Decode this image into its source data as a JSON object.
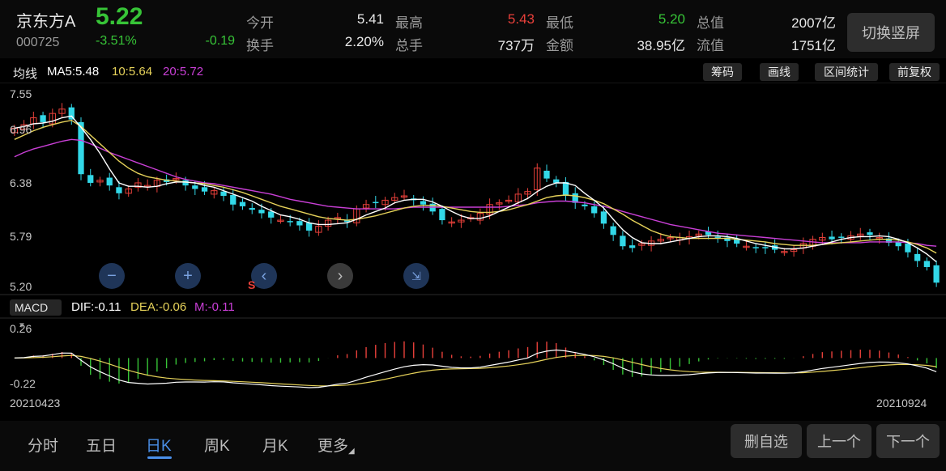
{
  "header": {
    "name": "京东方A",
    "code": "000725",
    "price": "5.22",
    "change_pct": "-3.51%",
    "change": "-0.19",
    "stats": [
      {
        "label": "今开",
        "value": "5.41",
        "color": "normal"
      },
      {
        "label": "最高",
        "value": "5.43",
        "color": "red"
      },
      {
        "label": "最低",
        "value": "5.20",
        "color": "green"
      },
      {
        "label": "总值",
        "value": "2007亿",
        "color": "normal"
      },
      {
        "label": "换手",
        "value": "2.20%",
        "color": "normal"
      },
      {
        "label": "总手",
        "value": "737万",
        "color": "normal"
      },
      {
        "label": "金额",
        "value": "38.95亿",
        "color": "normal"
      },
      {
        "label": "流值",
        "value": "1751亿",
        "color": "normal"
      }
    ],
    "switch_label": "切换竖屏"
  },
  "ma": {
    "title": "均线",
    "ma5": "MA5:5.48",
    "ma10": "10:5.64",
    "ma20": "20:5.72",
    "tools": [
      "筹码",
      "画线",
      "区间统计",
      "前复权"
    ]
  },
  "axis": {
    "price_ticks": [
      "7.55",
      "6.96",
      "6.38",
      "5.79",
      "5.20"
    ],
    "macd_ticks": [
      "0.26",
      "-0.22"
    ],
    "start_date": "20210423",
    "end_date": "20210924"
  },
  "macd": {
    "tag": "MACD",
    "dif": "DIF:-0.11",
    "dea": "DEA:-0.06",
    "m": "M:-0.11"
  },
  "marker": "S",
  "tabs": [
    "分时",
    "五日",
    "日K",
    "周K",
    "月K",
    "更多"
  ],
  "active_tab": "日K",
  "buttons": [
    "删自选",
    "上一个",
    "下一个"
  ],
  "colors": {
    "up": "#e8403a",
    "down": "#32d8e8",
    "ma5": "#ffffff",
    "ma10": "#e6d25a",
    "ma20": "#c93fd6",
    "accent": "#4a8fe8"
  },
  "chart_data": {
    "type": "candlestick",
    "y_range": [
      5.2,
      7.55
    ],
    "closes": [
      7.08,
      7.12,
      7.2,
      7.15,
      7.25,
      7.3,
      7.18,
      6.55,
      6.45,
      6.48,
      6.42,
      6.33,
      6.38,
      6.45,
      6.42,
      6.48,
      6.46,
      6.5,
      6.42,
      6.38,
      6.35,
      6.36,
      6.3,
      6.2,
      6.18,
      6.14,
      6.1,
      6.05,
      6.02,
      6.0,
      5.96,
      5.9,
      5.95,
      6.02,
      6.05,
      6.0,
      6.15,
      6.2,
      6.22,
      6.25,
      6.28,
      6.3,
      6.25,
      6.2,
      6.12,
      6.02,
      6.0,
      6.02,
      6.05,
      6.1,
      6.2,
      6.22,
      6.25,
      6.32,
      6.35,
      6.62,
      6.5,
      6.45,
      6.3,
      6.22,
      6.18,
      6.1,
      5.98,
      5.85,
      5.72,
      5.7,
      5.75,
      5.78,
      5.8,
      5.82,
      5.82,
      5.83,
      5.86,
      5.85,
      5.82,
      5.78,
      5.75,
      5.72,
      5.7,
      5.7,
      5.68,
      5.66,
      5.68,
      5.75,
      5.8,
      5.82,
      5.8,
      5.82,
      5.84,
      5.86,
      5.85,
      5.82,
      5.76,
      5.72,
      5.65,
      5.55,
      5.48,
      5.3
    ],
    "ma5": [
      7.08,
      7.1,
      7.13,
      7.14,
      7.16,
      7.2,
      7.22,
      7.09,
      6.95,
      6.79,
      6.61,
      6.45,
      6.41,
      6.41,
      6.4,
      6.41,
      6.44,
      6.46,
      6.46,
      6.45,
      6.42,
      6.4,
      6.36,
      6.32,
      6.28,
      6.24,
      6.18,
      6.13,
      6.08,
      6.06,
      6.03,
      5.99,
      5.97,
      5.97,
      5.98,
      5.99,
      6.03,
      6.08,
      6.12,
      6.16,
      6.22,
      6.25,
      6.26,
      6.26,
      6.23,
      6.18,
      6.12,
      6.07,
      6.04,
      6.04,
      6.07,
      6.12,
      6.17,
      6.22,
      6.27,
      6.35,
      6.41,
      6.45,
      6.45,
      6.42,
      6.33,
      6.25,
      6.16,
      6.03,
      5.91,
      5.82,
      5.76,
      5.75,
      5.75,
      5.77,
      5.79,
      5.81,
      5.83,
      5.84,
      5.84,
      5.83,
      5.81,
      5.78,
      5.75,
      5.73,
      5.71,
      5.69,
      5.69,
      5.7,
      5.72,
      5.74,
      5.77,
      5.8,
      5.82,
      5.83,
      5.83,
      5.84,
      5.83,
      5.8,
      5.76,
      5.7,
      5.63,
      5.54
    ],
    "ma10": [
      6.95,
      7.0,
      7.05,
      7.09,
      7.12,
      7.15,
      7.17,
      7.1,
      7.0,
      6.9,
      6.8,
      6.7,
      6.62,
      6.56,
      6.52,
      6.5,
      6.48,
      6.47,
      6.46,
      6.45,
      6.44,
      6.42,
      6.4,
      6.37,
      6.34,
      6.3,
      6.26,
      6.22,
      6.18,
      6.15,
      6.12,
      6.09,
      6.06,
      6.04,
      6.03,
      6.02,
      6.03,
      6.05,
      6.07,
      6.1,
      6.13,
      6.16,
      6.18,
      6.19,
      6.19,
      6.18,
      6.16,
      6.14,
      6.12,
      6.11,
      6.11,
      6.12,
      6.14,
      6.17,
      6.2,
      6.24,
      6.28,
      6.3,
      6.31,
      6.3,
      6.28,
      6.25,
      6.21,
      6.15,
      6.09,
      6.02,
      5.96,
      5.9,
      5.86,
      5.83,
      5.82,
      5.81,
      5.81,
      5.81,
      5.81,
      5.81,
      5.8,
      5.79,
      5.78,
      5.77,
      5.75,
      5.74,
      5.73,
      5.73,
      5.73,
      5.74,
      5.75,
      5.76,
      5.77,
      5.78,
      5.79,
      5.8,
      5.8,
      5.79,
      5.77,
      5.74,
      5.7,
      5.64
    ],
    "ma20": [
      6.75,
      6.8,
      6.84,
      6.87,
      6.9,
      6.93,
      6.95,
      6.94,
      6.9,
      6.85,
      6.8,
      6.76,
      6.72,
      6.68,
      6.64,
      6.6,
      6.56,
      6.52,
      6.49,
      6.47,
      6.45,
      6.44,
      6.42,
      6.4,
      6.38,
      6.36,
      6.34,
      6.32,
      6.29,
      6.26,
      6.24,
      6.22,
      6.2,
      6.18,
      6.17,
      6.16,
      6.15,
      6.15,
      6.15,
      6.15,
      6.15,
      6.16,
      6.17,
      6.17,
      6.17,
      6.17,
      6.17,
      6.17,
      6.17,
      6.17,
      6.17,
      6.17,
      6.18,
      6.19,
      6.2,
      6.22,
      6.23,
      6.24,
      6.24,
      6.23,
      6.22,
      6.2,
      6.18,
      6.15,
      6.12,
      6.09,
      6.06,
      6.03,
      6.0,
      5.97,
      5.95,
      5.93,
      5.91,
      5.89,
      5.87,
      5.86,
      5.85,
      5.84,
      5.83,
      5.82,
      5.81,
      5.8,
      5.79,
      5.78,
      5.77,
      5.76,
      5.76,
      5.76,
      5.76,
      5.76,
      5.77,
      5.77,
      5.77,
      5.77,
      5.76,
      5.75,
      5.73,
      5.72
    ],
    "macd_range": [
      -0.22,
      0.26
    ]
  }
}
